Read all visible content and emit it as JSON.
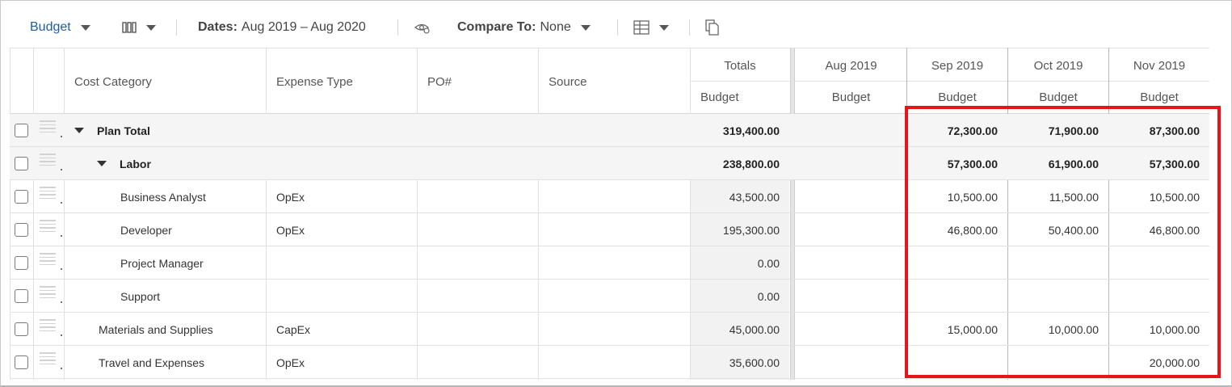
{
  "toolbar": {
    "view_label": "Budget",
    "dates_label": "Dates:",
    "dates_value": "Aug 2019 – Aug 2020",
    "compare_label": "Compare To:",
    "compare_value": "None"
  },
  "columns": {
    "cost_category": "Cost Category",
    "expense_type": "Expense Type",
    "po": "PO#",
    "source": "Source",
    "totals": "Totals",
    "totals_sub": "Budget",
    "months": [
      {
        "label": "Aug 2019",
        "sub": "Budget"
      },
      {
        "label": "Sep 2019",
        "sub": "Budget"
      },
      {
        "label": "Oct 2019",
        "sub": "Budget"
      },
      {
        "label": "Nov 2019",
        "sub": "Budget"
      }
    ]
  },
  "rows": [
    {
      "category": "Plan Total",
      "expense_type": "",
      "total": "319,400.00",
      "aug": "",
      "sep": "72,300.00",
      "oct": "71,900.00",
      "nov": "87,300.00",
      "bold": true,
      "expander": true,
      "indent": 0
    },
    {
      "category": "Labor",
      "expense_type": "",
      "total": "238,800.00",
      "aug": "",
      "sep": "57,300.00",
      "oct": "61,900.00",
      "nov": "57,300.00",
      "bold": true,
      "expander": true,
      "indent": 1
    },
    {
      "category": "Business Analyst",
      "expense_type": "OpEx",
      "total": "43,500.00",
      "aug": "",
      "sep": "10,500.00",
      "oct": "11,500.00",
      "nov": "10,500.00",
      "bold": false,
      "expander": false,
      "indent": 2
    },
    {
      "category": "Developer",
      "expense_type": "OpEx",
      "total": "195,300.00",
      "aug": "",
      "sep": "46,800.00",
      "oct": "50,400.00",
      "nov": "46,800.00",
      "bold": false,
      "expander": false,
      "indent": 2
    },
    {
      "category": "Project Manager",
      "expense_type": "",
      "total": "0.00",
      "aug": "",
      "sep": "",
      "oct": "",
      "nov": "",
      "bold": false,
      "expander": false,
      "indent": 2
    },
    {
      "category": "Support",
      "expense_type": "",
      "total": "0.00",
      "aug": "",
      "sep": "",
      "oct": "",
      "nov": "",
      "bold": false,
      "expander": false,
      "indent": 2
    },
    {
      "category": "Materials and Supplies",
      "expense_type": "CapEx",
      "total": "45,000.00",
      "aug": "",
      "sep": "15,000.00",
      "oct": "10,000.00",
      "nov": "10,000.00",
      "bold": false,
      "expander": false,
      "indent": 1
    },
    {
      "category": "Travel and Expenses",
      "expense_type": "OpEx",
      "total": "35,600.00",
      "aug": "",
      "sep": "",
      "oct": "",
      "nov": "20,000.00",
      "bold": false,
      "expander": false,
      "indent": 1
    }
  ],
  "highlight_color": "#e8141c"
}
